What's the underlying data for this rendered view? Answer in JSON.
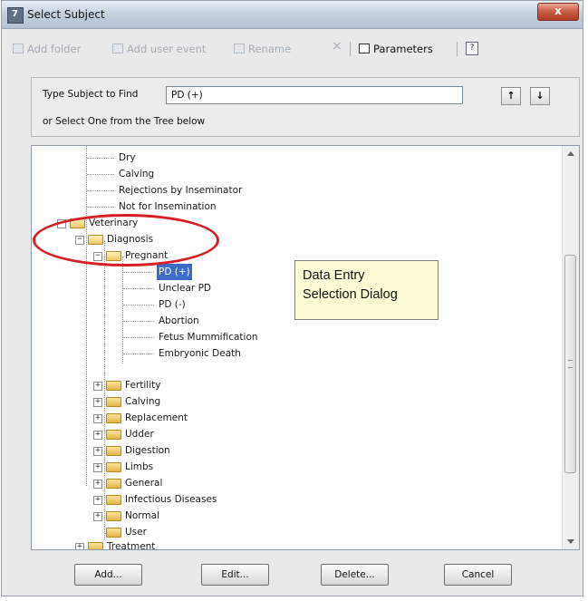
{
  "window": {
    "title": "Select Subject",
    "close_label": "x"
  },
  "toolbar": {
    "add_folder": "Add folder",
    "add_user_event": "Add user event",
    "rename": "Rename",
    "delete_x": "×",
    "parameters": "Parameters",
    "help": "?"
  },
  "find": {
    "label": "Type Subject to Find",
    "value": "PD (+)",
    "hint": "or Select One from the Tree below",
    "up_arrow": "↑",
    "down_arrow": "↓"
  },
  "tree": {
    "items": [
      {
        "label": "Dry"
      },
      {
        "label": "Calving"
      },
      {
        "label": "Rejections by Inseminator"
      },
      {
        "label": "Not for Insemination"
      },
      {
        "label": "Veterinary"
      },
      {
        "label": "Diagnosis"
      },
      {
        "label": "Pregnant"
      },
      {
        "label": "PD (+)",
        "selected": true
      },
      {
        "label": "Unclear PD"
      },
      {
        "label": "PD (-)"
      },
      {
        "label": "Abortion"
      },
      {
        "label": "Fetus Mummification"
      },
      {
        "label": "Embryonic Death"
      },
      {
        "label": "Fertility"
      },
      {
        "label": "Calving"
      },
      {
        "label": "Replacement"
      },
      {
        "label": "Udder"
      },
      {
        "label": "Digestion"
      },
      {
        "label": "Limbs"
      },
      {
        "label": "General"
      },
      {
        "label": "Infectious Diseases"
      },
      {
        "label": "Normal"
      },
      {
        "label": "User"
      },
      {
        "label": "Treatment"
      }
    ]
  },
  "callout": {
    "line1": "Data Entry",
    "line2": "Selection Dialog"
  },
  "buttons": {
    "add": "Add...",
    "edit": "Edit...",
    "delete": "Delete...",
    "cancel": "Cancel"
  },
  "colors": {
    "highlight_ring": "#d61f24",
    "selection": "#3c6cc7",
    "callout_bg": "#fdfcd7"
  }
}
